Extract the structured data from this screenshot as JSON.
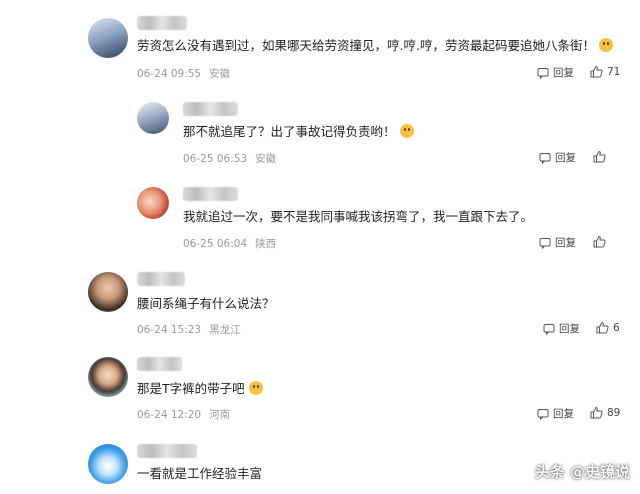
{
  "reply_label": "回复",
  "comments": [
    {
      "text": "劳资怎么没有遇到过，如果哪天给劳资撞见，哼.哼.哼，劳资最起码要追她八条街！",
      "date": "06-24 09:55",
      "location": "安徽",
      "likes": "71",
      "emoji": true
    },
    {
      "text": "那不就追尾了？出了事故记得负责哟！",
      "date": "06-25 06:53",
      "location": "安徽",
      "likes": "",
      "emoji": true
    },
    {
      "text": "我就追过一次，要不是我同事喊我该拐弯了，我一直跟下去了。",
      "date": "06-25 06:04",
      "location": "陕西",
      "likes": "",
      "emoji": false
    },
    {
      "text": "腰间系绳子有什么说法？",
      "date": "06-24 15:23",
      "location": "黑龙江",
      "likes": "6",
      "emoji": false
    },
    {
      "text": "那是T字裤的带子吧",
      "date": "06-24 12:20",
      "location": "河南",
      "likes": "89",
      "emoji": true
    },
    {
      "text": "一看就是工作经验丰富",
      "date": "",
      "location": "",
      "likes": "",
      "emoji": false
    }
  ],
  "watermark": "头条 @史镜说",
  "colors": {
    "text": "#1f1f1f",
    "meta": "#999999",
    "emoji": "#f7c33f"
  }
}
